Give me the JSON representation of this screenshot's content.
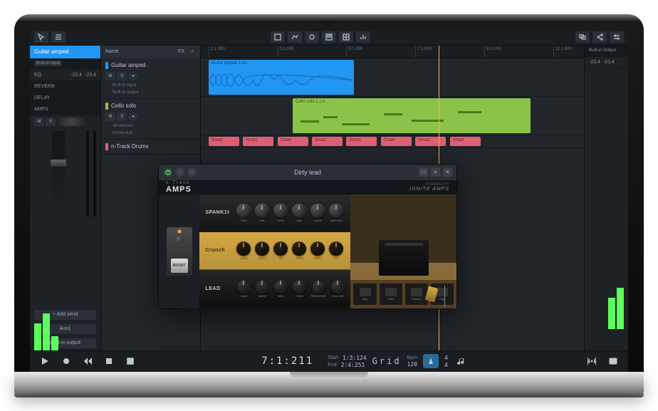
{
  "inspector": {
    "track_name": "Guitar amped",
    "input": "Built-in Input",
    "eq_label": "EQ",
    "db_left": "-23.4",
    "db_right": "-23.4",
    "fx": {
      "reverb": "REVERB",
      "delay": "DELAY",
      "amps": "AMPS"
    },
    "m": "M",
    "s": "S",
    "add_send": "+ Add send",
    "aux": "Aux1",
    "output": "Built-in output"
  },
  "tracks_header": {
    "name": "Name",
    "fx": "FX"
  },
  "tracks": [
    {
      "name": "Guitar amped",
      "color": "#2196f3",
      "io1": "Built-in Input",
      "io2": "Built-in output"
    },
    {
      "name": "Cello solo",
      "color": "#8bc34a",
      "io1": "All devices",
      "io2": "Orchestral"
    },
    {
      "name": "n-Track Drums",
      "color": "#e06075",
      "io1": "",
      "io2": ""
    }
  ],
  "ruler_ticks": [
    "1.1.000",
    "3.1.000",
    "5.1.000",
    "7.1.000",
    "9.1.000",
    "11.1.000"
  ],
  "clips": {
    "guitar": "Guitar amped 1.01",
    "cello": "Cello solo 1.1.n",
    "drum": "Smart"
  },
  "output_panel": {
    "label": "Built-in Output",
    "db_left": "-23.4",
    "db_right": "-23.4"
  },
  "transport": {
    "counter": "7:1:211",
    "start_lbl": "Start",
    "start": "1:3:124",
    "end_lbl": "End",
    "end": "2:4:251",
    "grid": "Grid",
    "bpm_lbl": "Bpm",
    "bpm": "120",
    "sig_top": "4",
    "sig_bot": "4"
  },
  "plugin": {
    "title": "Dirty lead",
    "brand_small": "n-Track",
    "brand": "AMPS",
    "powered": "POWERED BY",
    "ignite": "IGNITE AMPS",
    "pedal_label": "BOOST",
    "amps": [
      {
        "name": "SPANK1t",
        "knobs": [
          "PRE",
          "VOL",
          "LOW",
          "MID",
          "HIGH",
          "MASTER"
        ]
      },
      {
        "name": "Crunch",
        "knobs": [
          "GAIN",
          "BASS",
          "MID",
          "TREB",
          "PRES",
          "VOL"
        ]
      },
      {
        "name": "LEAD",
        "knobs": [
          "GAIN",
          "BASS",
          "MID",
          "TREB",
          "PRESENCE",
          "VOLUME"
        ]
      }
    ],
    "thumbs": [
      "Amp",
      "Solo",
      "Rhythm",
      "High"
    ]
  }
}
